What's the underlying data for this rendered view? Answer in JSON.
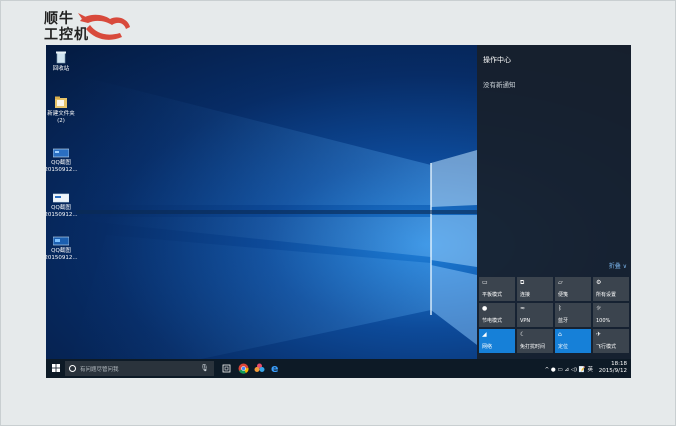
{
  "logo": {
    "line1": "顺牛",
    "line2": "工控机",
    "brand_color": "#d84a3c"
  },
  "desktop": {
    "icons": [
      {
        "icon": "recycle-bin-icon",
        "label": "回收站"
      },
      {
        "icon": "folder-icon",
        "label": "新建文件夹\n(2)"
      },
      {
        "icon": "screenshot-file-icon",
        "label": "QQ截图\n20150912..."
      },
      {
        "icon": "screenshot-file-icon",
        "label": "QQ截图\n20150912..."
      },
      {
        "icon": "screenshot-file-icon",
        "label": "QQ截图\n20150912..."
      }
    ]
  },
  "action_center": {
    "title": "操作中心",
    "empty_text": "没有新通知",
    "collapse_label": "折叠 ∨",
    "tiles": [
      {
        "label": "平板模式",
        "icon": "tablet-mode-icon",
        "active": false
      },
      {
        "label": "连接",
        "icon": "connect-icon",
        "active": false
      },
      {
        "label": "便笺",
        "icon": "note-icon",
        "active": false
      },
      {
        "label": "所有设置",
        "icon": "gear-icon",
        "active": false
      },
      {
        "label": "节电模式",
        "icon": "battery-saver-icon",
        "active": false
      },
      {
        "label": "VPN",
        "icon": "vpn-icon",
        "active": false
      },
      {
        "label": "蓝牙",
        "icon": "bluetooth-icon",
        "active": false
      },
      {
        "label": "100%",
        "icon": "brightness-icon",
        "active": false
      },
      {
        "label": "网络",
        "icon": "network-icon",
        "active": true
      },
      {
        "label": "免打扰时间",
        "icon": "quiet-hours-icon",
        "active": false
      },
      {
        "label": "定位",
        "icon": "location-icon",
        "active": true
      },
      {
        "label": "飞行模式",
        "icon": "airplane-icon",
        "active": false
      }
    ]
  },
  "taskbar": {
    "search_placeholder": "有问题尽管问我",
    "tray_text": "^ ● ▭ ⊿ ◁) 📝 英",
    "time": "18:18",
    "date": "2015/9/12"
  }
}
